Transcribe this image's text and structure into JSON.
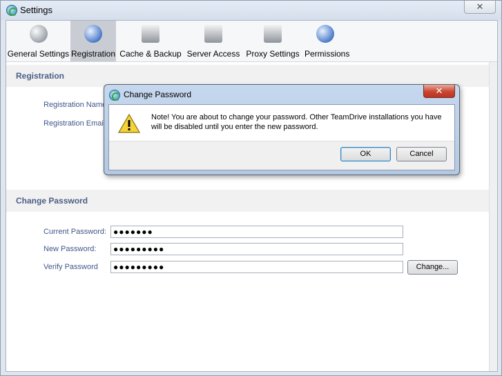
{
  "window": {
    "title": "Settings",
    "close_glyph": "✕"
  },
  "toolbar": [
    {
      "label": "General Settings",
      "icon": "gears-icon"
    },
    {
      "label": "Registration",
      "icon": "globe-user-icon"
    },
    {
      "label": "Cache & Backup",
      "icon": "disk-icon"
    },
    {
      "label": "Server Access",
      "icon": "server-icon"
    },
    {
      "label": "Proxy Settings",
      "icon": "server-gear-icon"
    },
    {
      "label": "Permissions",
      "icon": "shield-icon"
    }
  ],
  "registration": {
    "heading": "Registration",
    "name_label": "Registration Name",
    "email_label": "Registration Email"
  },
  "change_password": {
    "heading": "Change Password",
    "current_label": "Current Password:",
    "current_value": "●●●●●●●",
    "new_label": "New Password:",
    "new_value": "●●●●●●●●●",
    "verify_label": "Verify Password",
    "verify_value": "●●●●●●●●●",
    "change_button": "Change..."
  },
  "dialog": {
    "title": "Change Password",
    "close_glyph": "✕",
    "message": "Note! You are about to change your password. Other TeamDrive installations you have will be disabled until you enter the new password.",
    "ok": "OK",
    "cancel": "Cancel"
  },
  "colors": {
    "accent": "#4a5e86",
    "label": "#40568a",
    "dialog_close": "#c9452f"
  }
}
